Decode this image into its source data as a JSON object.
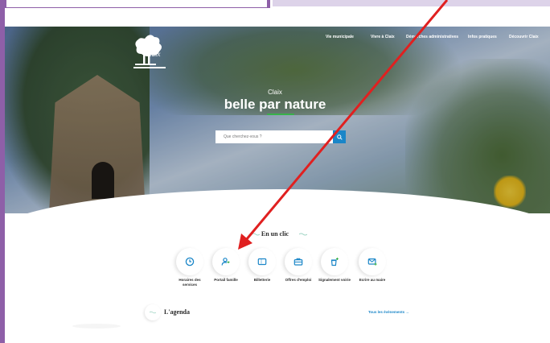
{
  "site": {
    "logo_text": "Claix"
  },
  "nav": {
    "items": [
      {
        "label": "Vie municipale"
      },
      {
        "label": "Vivre à Claix"
      },
      {
        "label": "Démarches administratives"
      },
      {
        "label": "Infos pratiques"
      },
      {
        "label": "Découvrir Claix"
      }
    ]
  },
  "hero": {
    "subtitle": "Claix",
    "title": "belle par nature",
    "accent_color": "#38b14a"
  },
  "search": {
    "placeholder": "Que cherchez-vous ?",
    "button_color": "#1a86c8"
  },
  "quick_links": {
    "title": "En un clic",
    "items": [
      {
        "label": "Horaires des services",
        "icon": "clock-icon"
      },
      {
        "label": "Portail famille",
        "icon": "user-heart-icon"
      },
      {
        "label": "Billetterie",
        "icon": "ticket-icon"
      },
      {
        "label": "Offres d'emploi",
        "icon": "briefcase-icon"
      },
      {
        "label": "Signalement voirie",
        "icon": "trash-alert-icon"
      },
      {
        "label": "Ecrire au maire",
        "icon": "mail-plus-icon"
      }
    ],
    "icon_color": "#1a86c8",
    "plus_color": "#38b14a"
  },
  "agenda": {
    "title": "L'agenda",
    "link_label": "Tous les évènements →"
  },
  "annotation": {
    "arrow_color": "#e02020"
  }
}
